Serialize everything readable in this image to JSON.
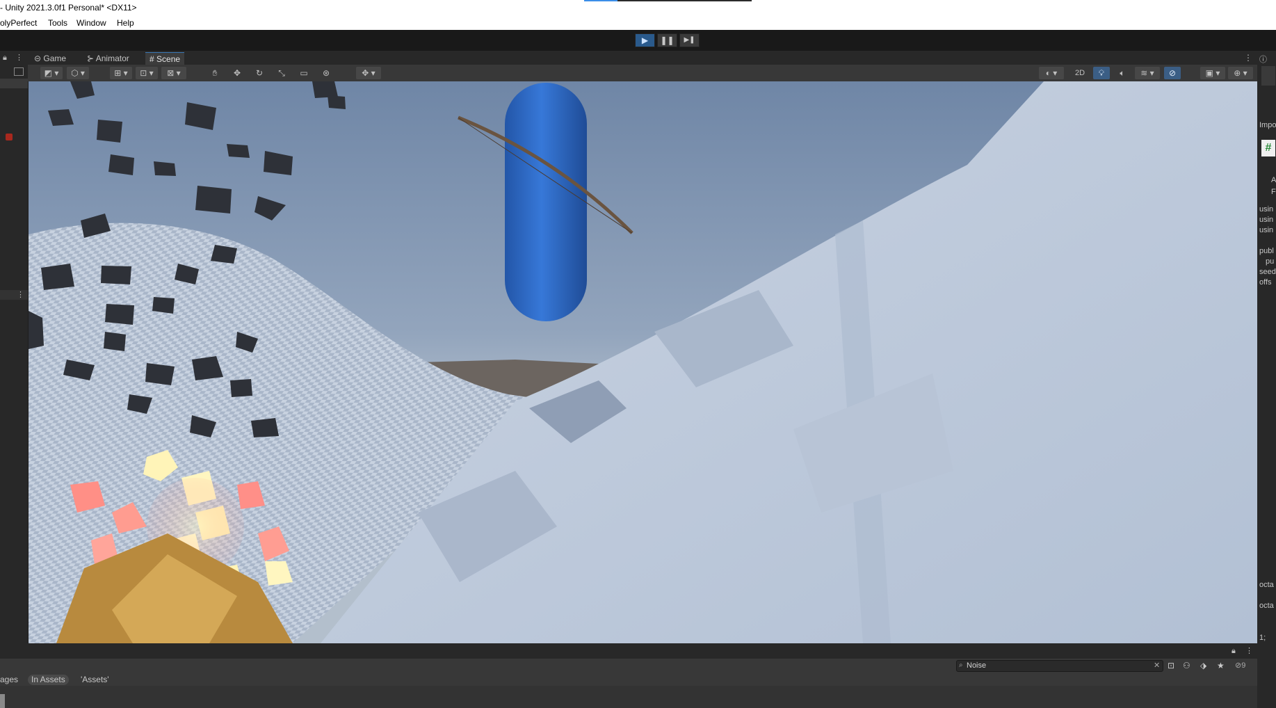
{
  "window": {
    "title": "- Unity 2021.3.0f1 Personal* <DX11>",
    "load_progress": 0.2
  },
  "menubar": {
    "items": [
      "olyPerfect",
      "Tools",
      "Window",
      "Help"
    ]
  },
  "playbar": {
    "play": "▶",
    "pause": "❚❚",
    "step": "▶❚",
    "play_active": true
  },
  "tabs": [
    {
      "icon": "gamepad-icon",
      "glyph": "⊝",
      "label": "Game"
    },
    {
      "icon": "animator-icon",
      "glyph": "⊱",
      "label": "Animator"
    },
    {
      "icon": "scene-grid-icon",
      "glyph": "#",
      "label": "Scene",
      "active": true
    }
  ],
  "scene_toolbar": {
    "twod_label": "2D",
    "lighting_on": true,
    "hidden_objects_toggle_on": true
  },
  "inspector_fragments": [
    "Impo",
    "#",
    "A",
    "F",
    "usin",
    "usin",
    "usin",
    "publ",
    "pu",
    "seed",
    "offs",
    "octa",
    "octa",
    "1;"
  ],
  "project": {
    "search_value": "Noise",
    "hidden_count": "9",
    "breadcrumbs": [
      "ages",
      "In Assets",
      "'Assets'"
    ]
  },
  "colors": {
    "accent": "#3b8ee8",
    "play_active": "#2a5a8c",
    "capsule": "#2f67c6",
    "sky_top": "#6f87a8",
    "terrain": "#b9c7da",
    "panel": "#282828"
  }
}
